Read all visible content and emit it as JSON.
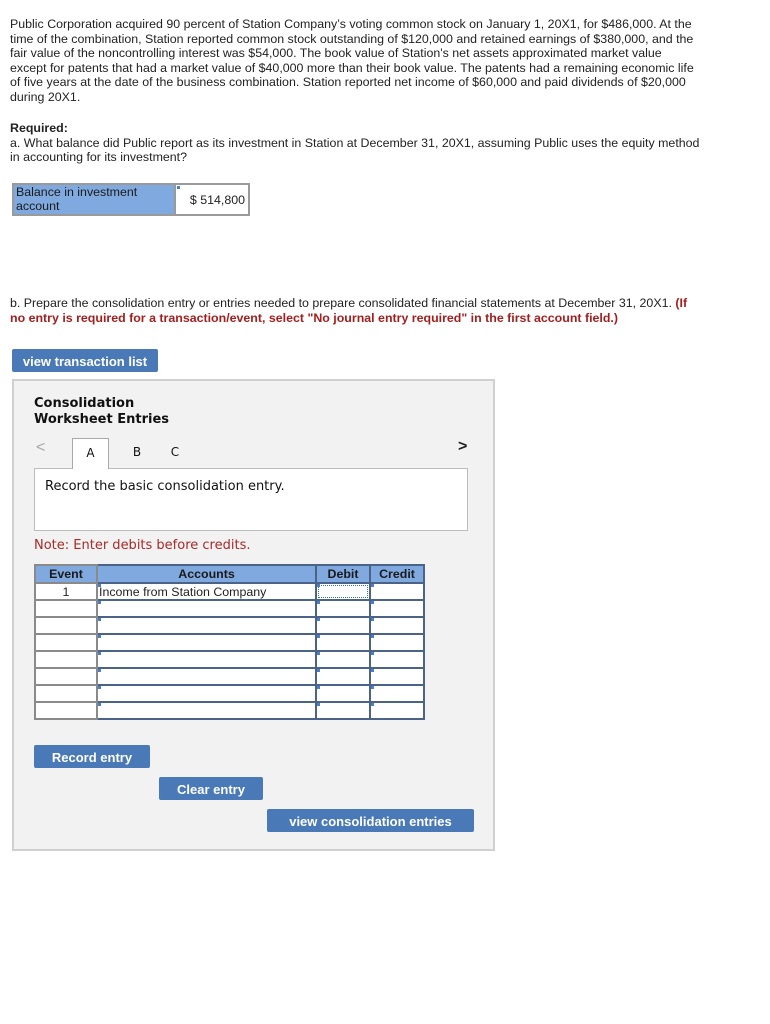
{
  "problem": {
    "text": "Public Corporation acquired 90 percent of Station Company’s voting common stock on January 1, 20X1, for $486,000. At the time of the combination, Station reported common stock outstanding of $120,000 and retained earnings of $380,000, and the fair value of the noncontrolling interest was $54,000. The book value of Station's net assets approximated market value except for patents that had a market value of $40,000 more than their book value. The patents had a remaining economic life of five years at the date of the business combination. Station reported net income of $60,000 and paid dividends of $20,000 during 20X1."
  },
  "required": {
    "heading": "Required:",
    "part_a": "a. What balance did Public report as its investment in Station at December 31, 20X1, assuming Public uses the equity method in accounting for its investment?"
  },
  "balance": {
    "label": "Balance in investment account",
    "value": "$ 514,800"
  },
  "part_b": {
    "text": "b. Prepare the consolidation entry or entries needed to prepare consolidated financial statements at December 31, 20X1.",
    "hint": "(If no entry is required for a transaction/event, select \"No journal entry required\" in the first account field.)"
  },
  "buttons": {
    "view_transaction_list": "view transaction list",
    "record_entry": "Record entry",
    "clear_entry": "Clear entry",
    "view_consolidation_entries": "view consolidation entries"
  },
  "worksheet": {
    "title_line1": "Consolidation",
    "title_line2": "Worksheet Entries",
    "nav_prev": "<",
    "nav_next": ">",
    "tabs": [
      {
        "label": "A",
        "active": true
      },
      {
        "label": "B",
        "active": false
      },
      {
        "label": "C",
        "active": false
      }
    ],
    "instruction": "Record the basic consolidation entry.",
    "note": "Note: Enter debits before credits.",
    "columns": {
      "event": "Event",
      "accounts": "Accounts",
      "debit": "Debit",
      "credit": "Credit"
    },
    "rows": [
      {
        "event": "1",
        "account": "Income from Station Company",
        "debit": "",
        "credit": ""
      },
      {
        "event": "",
        "account": "",
        "debit": "",
        "credit": ""
      },
      {
        "event": "",
        "account": "",
        "debit": "",
        "credit": ""
      },
      {
        "event": "",
        "account": "",
        "debit": "",
        "credit": ""
      },
      {
        "event": "",
        "account": "",
        "debit": "",
        "credit": ""
      },
      {
        "event": "",
        "account": "",
        "debit": "",
        "credit": ""
      },
      {
        "event": "",
        "account": "",
        "debit": "",
        "credit": ""
      },
      {
        "event": "",
        "account": "",
        "debit": "",
        "credit": ""
      }
    ]
  },
  "colors": {
    "button": "#4a79b8",
    "header_fill": "#80a9e0",
    "hint_red": "#a31f1f"
  }
}
